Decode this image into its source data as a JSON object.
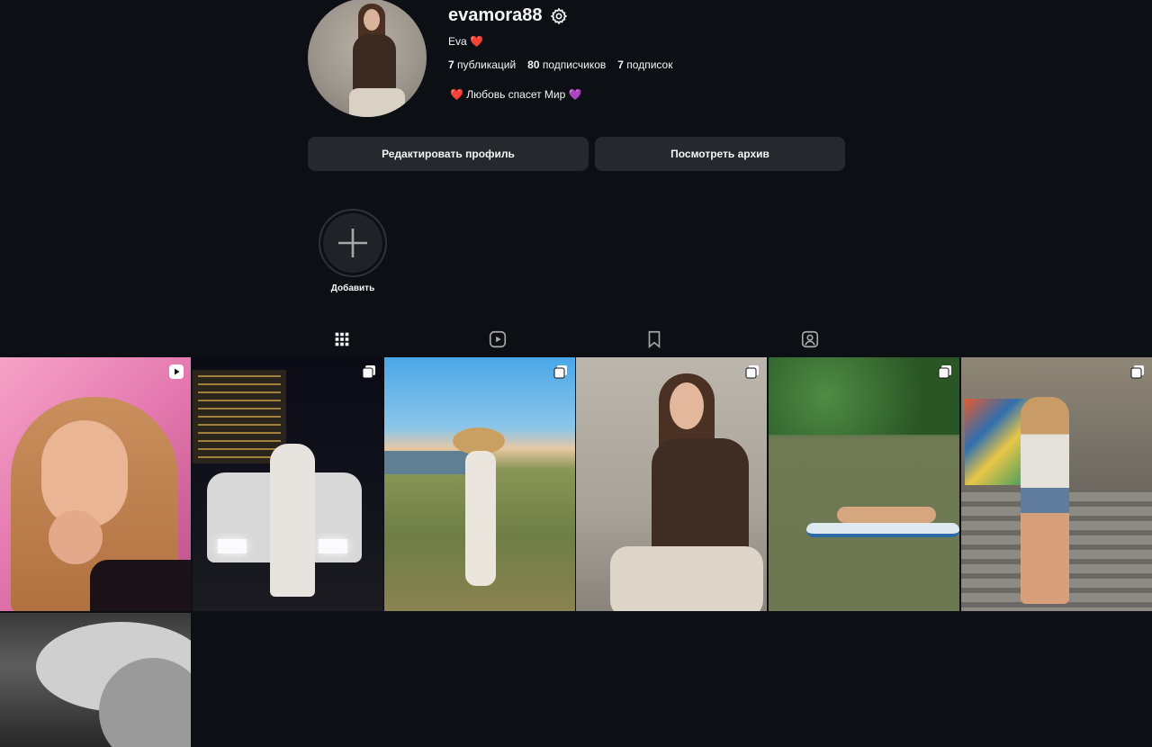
{
  "profile": {
    "username": "evamora88",
    "full_name": "Eva",
    "full_name_emoji": "❤️",
    "stats": {
      "posts_count": "7",
      "posts_label": "публикаций",
      "followers_count": "80",
      "followers_label": "подписчиков",
      "following_count": "7",
      "following_label": "подписок"
    },
    "bio": "❤️ Любовь спасет Мир 💜"
  },
  "actions": {
    "edit_profile": "Редактировать профиль",
    "view_archive": "Посмотреть архив"
  },
  "highlights": {
    "add_label": "Добавить"
  },
  "tabs": [
    {
      "name": "posts",
      "icon": "grid-icon",
      "active": true
    },
    {
      "name": "reels",
      "icon": "reels-icon",
      "active": false
    },
    {
      "name": "saved",
      "icon": "bookmark-icon",
      "active": false
    },
    {
      "name": "tagged",
      "icon": "tagged-icon",
      "active": false
    }
  ],
  "posts": [
    {
      "type": "reel",
      "badge_icon": "reel-badge-icon"
    },
    {
      "type": "carousel",
      "badge_icon": "carousel-badge-icon"
    },
    {
      "type": "carousel",
      "badge_icon": "carousel-badge-icon"
    },
    {
      "type": "carousel",
      "badge_icon": "carousel-badge-icon"
    },
    {
      "type": "carousel",
      "badge_icon": "carousel-badge-icon"
    },
    {
      "type": "carousel",
      "badge_icon": "carousel-badge-icon"
    },
    {
      "type": "photo",
      "badge_icon": ""
    }
  ],
  "colors": {
    "background": "#0c1014",
    "button_bg": "#25292e",
    "text": "#f5f5f5"
  }
}
